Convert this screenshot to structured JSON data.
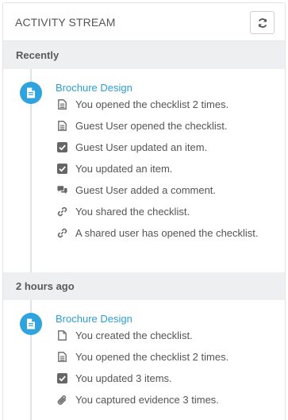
{
  "panel": {
    "title": "ACTIVITY STREAM",
    "refresh_icon": "refresh-icon"
  },
  "groups": [
    {
      "heading": "Recently",
      "entry_title": "Brochure Design",
      "badge_icon": "document-icon",
      "items": [
        {
          "icon": "document-lines-icon",
          "text": "You opened the checklist 2 times."
        },
        {
          "icon": "document-lines-icon",
          "text": "Guest User opened the checklist."
        },
        {
          "icon": "checkbox-icon",
          "text": "Guest User updated an item."
        },
        {
          "icon": "checkbox-icon",
          "text": "You updated an item."
        },
        {
          "icon": "comments-icon",
          "text": "Guest User added a comment."
        },
        {
          "icon": "link-icon",
          "text": "You shared the checklist."
        },
        {
          "icon": "link-icon",
          "text": "A shared user has opened the checklist."
        }
      ]
    },
    {
      "heading": "2 hours ago",
      "entry_title": "Brochure Design",
      "badge_icon": "document-icon",
      "items": [
        {
          "icon": "document-outline-icon",
          "text": "You created the checklist."
        },
        {
          "icon": "document-lines-icon",
          "text": "You opened the checklist 2 times."
        },
        {
          "icon": "checkbox-icon",
          "text": "You updated 3 items."
        },
        {
          "icon": "paperclip-icon",
          "text": "You captured evidence 3 times."
        }
      ]
    }
  ],
  "colors": {
    "accent": "#2ea3de",
    "link": "#2a9fd6",
    "section_bg": "#eeeff1",
    "icon": "#666666"
  }
}
